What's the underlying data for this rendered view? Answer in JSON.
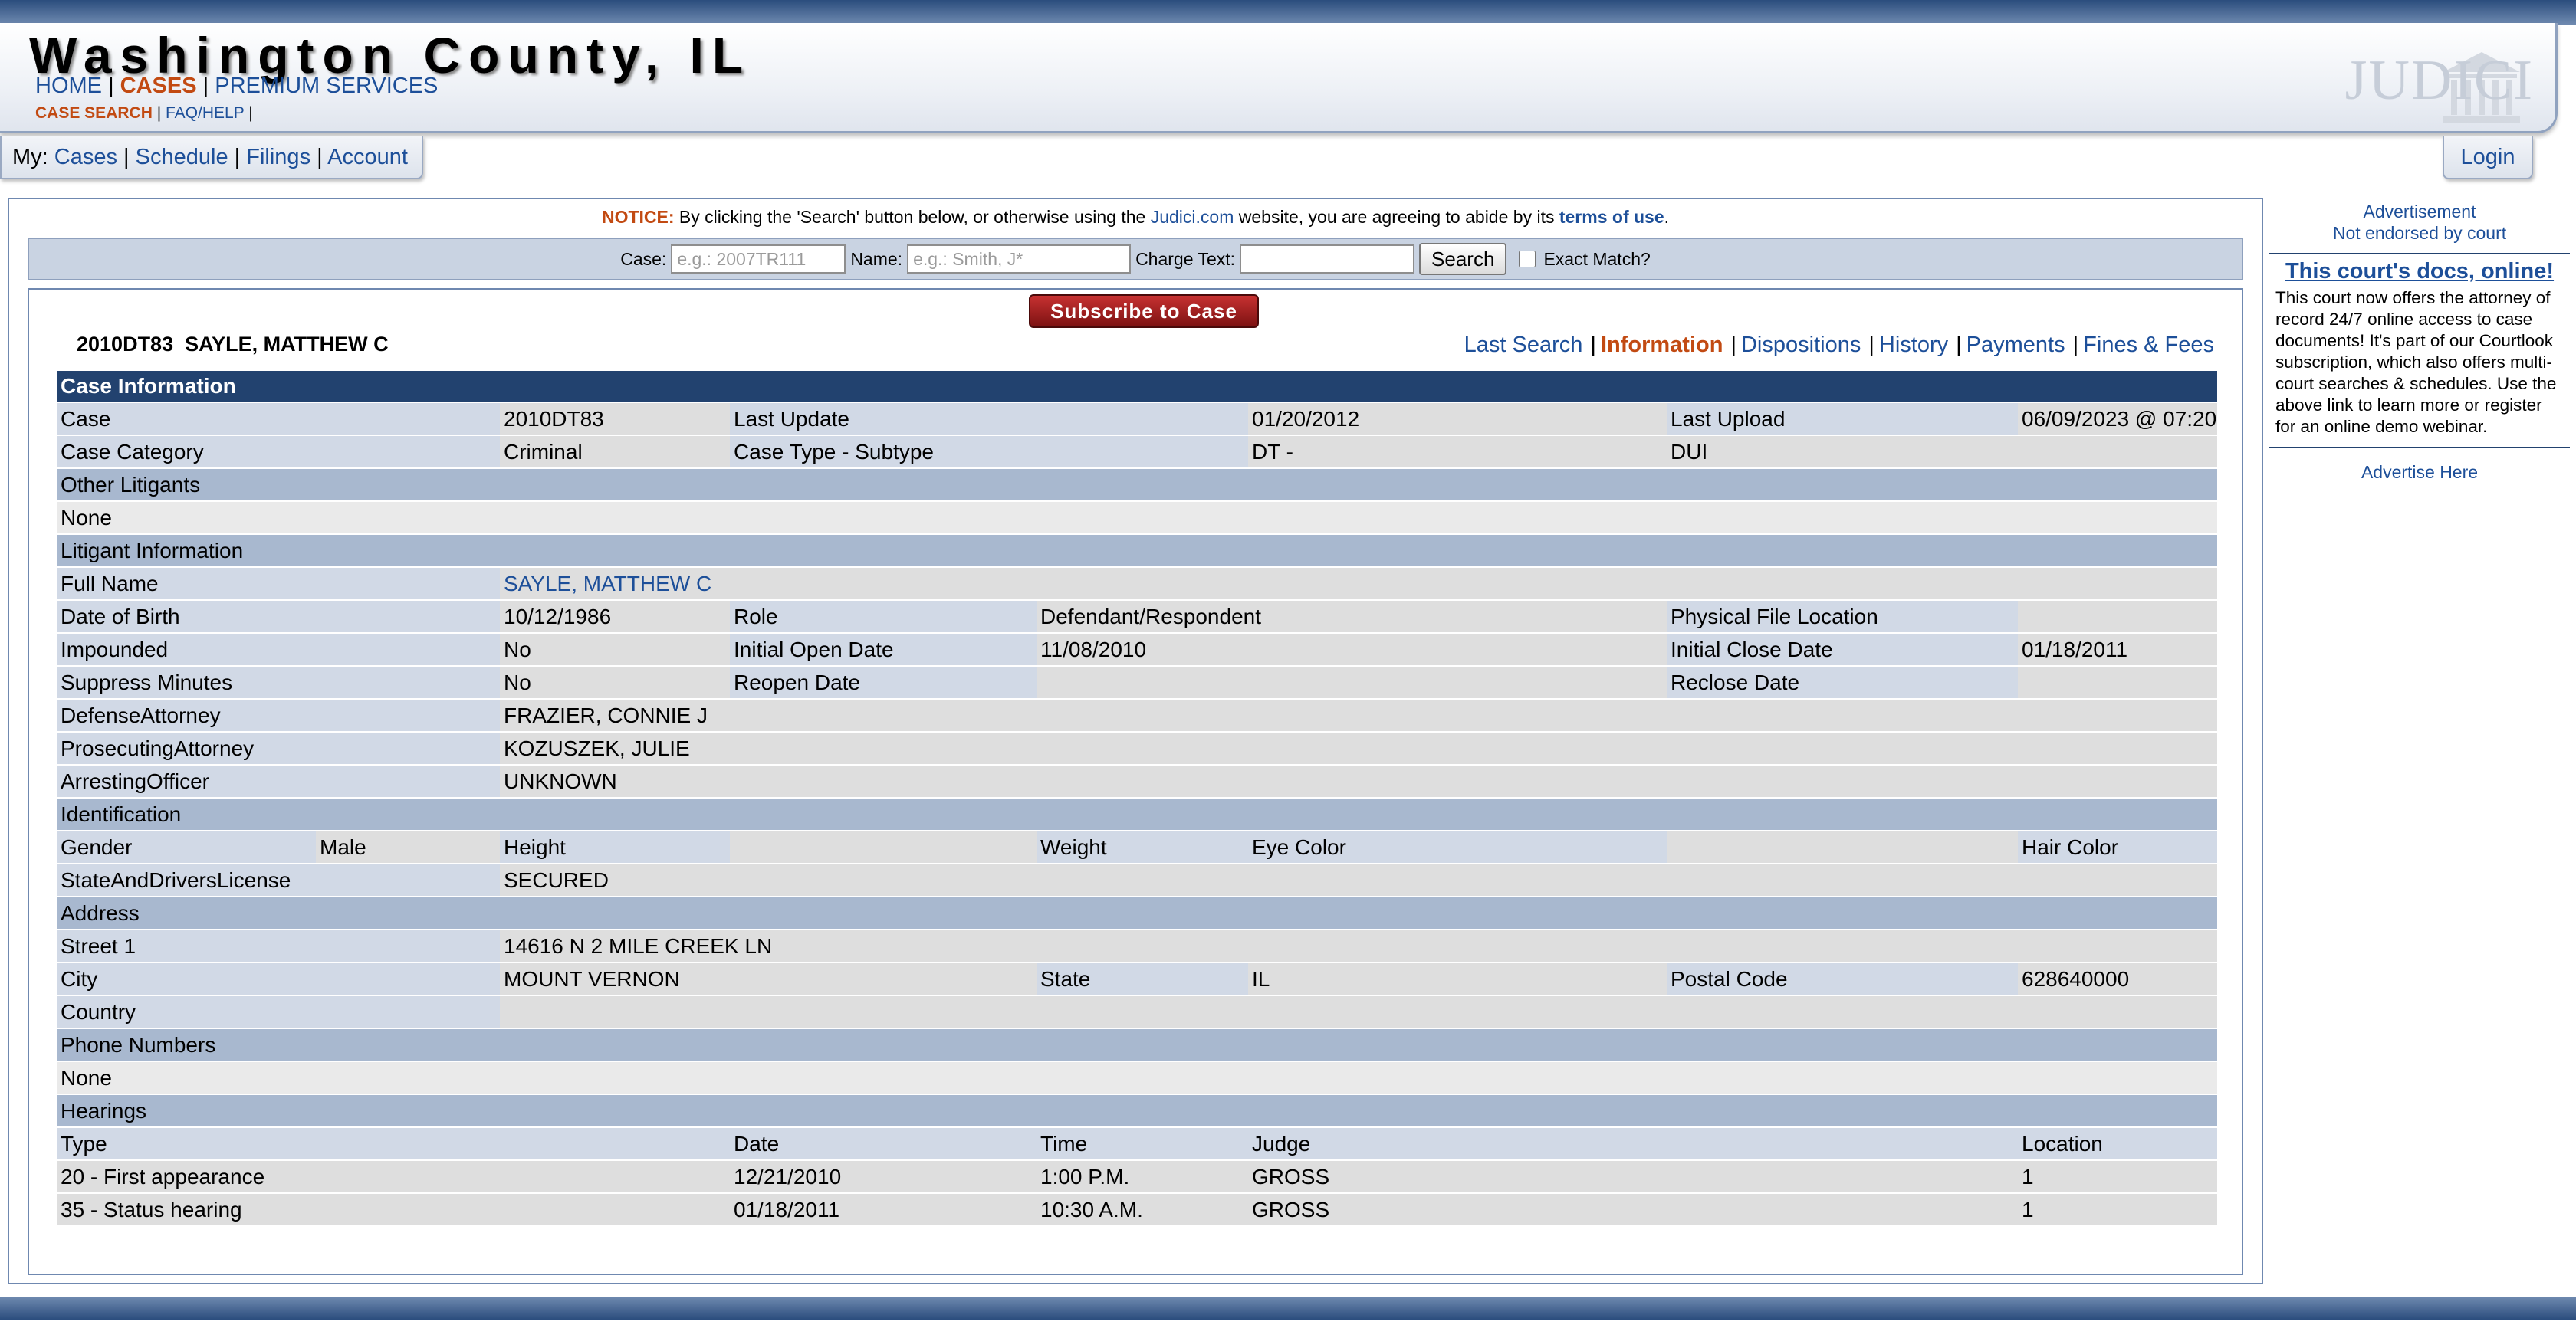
{
  "header": {
    "site_title": "Washington County, IL",
    "nav": {
      "home": "HOME",
      "cases": "CASES",
      "premium": "PREMIUM SERVICES",
      "sep": "|"
    },
    "subnav": {
      "case_search": "CASE SEARCH",
      "faq": "FAQ/HELP",
      "sep": "|"
    },
    "logo": "JUDICI"
  },
  "mybar": {
    "prefix": "My:",
    "cases": "Cases",
    "schedule": "Schedule",
    "filings": "Filings",
    "account": "Account",
    "sep": "|"
  },
  "login": "Login",
  "notice": {
    "label": "NOTICE:",
    "text1": " By clicking the 'Search' button below, or otherwise using the ",
    "link": "Judici.com",
    "text2": " website, you are agreeing to abide by its ",
    "terms": "terms of use",
    "end": "."
  },
  "search": {
    "case_label": "Case:",
    "case_placeholder": "e.g.: 2007TR111",
    "name_label": "Name:",
    "name_placeholder": "e.g.: Smith, J*",
    "charge_label": "Charge Text:",
    "charge_value": "",
    "button": "Search",
    "exact_label": "Exact Match?"
  },
  "case": {
    "subscribe": "Subscribe to Case",
    "title": "2010DT83  SAYLE, MATTHEW C",
    "tabs": {
      "last_search": "Last Search",
      "information": "Information",
      "dispositions": "Dispositions",
      "history": "History",
      "payments": "Payments",
      "fines": "Fines & Fees",
      "sep": "|"
    }
  },
  "info": {
    "case_information": "Case Information",
    "case_label": "Case",
    "case_value": "2010DT83",
    "last_update_label": "Last Update",
    "last_update_value": "01/20/2012",
    "last_upload_label": "Last Upload",
    "last_upload_value": "06/09/2023 @ 07:20",
    "category_label": "Case Category",
    "category_value": "Criminal",
    "type_label": "Case Type - Subtype",
    "type_value": "DT -",
    "subtype_value": "DUI",
    "other_litigants": "Other Litigants",
    "other_none": "None",
    "litigant_information": "Litigant Information",
    "full_name_label": "Full Name",
    "full_name_value": "SAYLE, MATTHEW C",
    "dob_label": "Date of Birth",
    "dob_value": "10/12/1986",
    "role_label": "Role",
    "role_value": "Defendant/Respondent",
    "physical_label": "Physical File Location",
    "impounded_label": "Impounded",
    "impounded_value": "No",
    "open_label": "Initial Open Date",
    "open_value": "11/08/2010",
    "close_label": "Initial Close Date",
    "close_value": "01/18/2011",
    "suppress_label": "Suppress Minutes",
    "suppress_value": "No",
    "reopen_label": "Reopen Date",
    "reclose_label": "Reclose Date",
    "defense_label": "DefenseAttorney",
    "defense_value": "FRAZIER, CONNIE J",
    "prosecuting_label": "ProsecutingAttorney",
    "prosecuting_value": "KOZUSZEK, JULIE",
    "arresting_label": "ArrestingOfficer",
    "arresting_value": "UNKNOWN",
    "identification": "Identification",
    "gender_label": "Gender",
    "gender_value": "Male",
    "height_label": "Height",
    "weight_label": "Weight",
    "eye_label": "Eye Color",
    "hair_label": "Hair Color",
    "license_label": "StateAndDriversLicense",
    "license_value": "SECURED",
    "address": "Address",
    "street_label": "Street 1",
    "street_value": "14616 N 2 MILE CREEK LN",
    "city_label": "City",
    "city_value": "MOUNT VERNON",
    "state_label": "State",
    "state_value": "IL",
    "postal_label": "Postal Code",
    "postal_value": "628640000",
    "country_label": "Country",
    "phone_numbers": "Phone Numbers",
    "phone_none": "None",
    "hearings": "Hearings",
    "hearing_headers": [
      "Type",
      "Date",
      "Time",
      "Judge",
      "Location"
    ],
    "hearing_rows": [
      [
        "20 - First appearance",
        "12/21/2010",
        "1:00 P.M.",
        "GROSS",
        "1"
      ],
      [
        "35 - Status hearing",
        "01/18/2011",
        "10:30 A.M.",
        "GROSS",
        "1"
      ]
    ]
  },
  "sidebar": {
    "ad_label": "Advertisement",
    "ad_disclaimer": "Not endorsed by court",
    "ad_title": "This court's docs, online!",
    "ad_body": "This court now offers the attorney of record 24/7 online access to case documents! It's part of our Courtlook subscription, which also offers multi-court searches & schedules. Use the above link to learn more or register for an online demo webinar.",
    "advertise": "Advertise Here"
  },
  "colors": {
    "nav_link": "#1d4f99",
    "active": "#c24a12",
    "section_header": "#22426f",
    "section_row": "#a8b8cf",
    "label_cell": "#d1d9e6",
    "value_cell": "#dedede"
  }
}
